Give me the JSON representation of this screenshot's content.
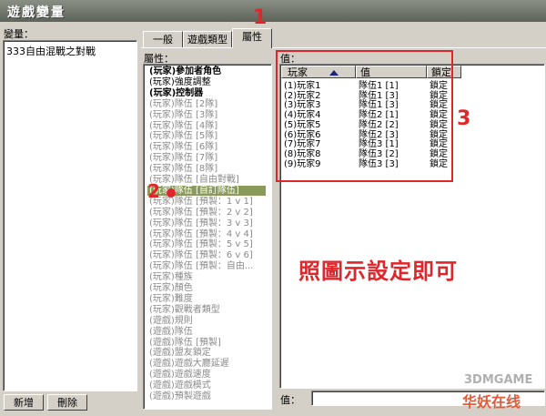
{
  "window": {
    "title": "遊戲變量"
  },
  "variables": {
    "label": "變量：",
    "items": [
      "333自由混戰之對戰"
    ]
  },
  "buttons": {
    "add": "新增",
    "delete": "刪除"
  },
  "tabs": [
    "一般",
    "遊戲類型",
    "屬性"
  ],
  "attributes": {
    "label": "屬性：",
    "items": [
      {
        "text": "(玩家)參加者角色",
        "state": "bold"
      },
      {
        "text": "(玩家)強度調整",
        "state": "normal"
      },
      {
        "text": "(玩家)控制器",
        "state": "bold"
      },
      {
        "text": "(玩家)隊伍 [2隊]",
        "state": "dim"
      },
      {
        "text": "(玩家)隊伍 [3隊]",
        "state": "dim"
      },
      {
        "text": "(玩家)隊伍 [4隊]",
        "state": "dim"
      },
      {
        "text": "(玩家)隊伍 [5隊]",
        "state": "dim"
      },
      {
        "text": "(玩家)隊伍 [6隊]",
        "state": "dim"
      },
      {
        "text": "(玩家)隊伍 [7隊]",
        "state": "dim"
      },
      {
        "text": "(玩家)隊伍 [8隊]",
        "state": "dim"
      },
      {
        "text": "(玩家)隊伍 [自由對戰]",
        "state": "dim"
      },
      {
        "text": "(玩家)隊伍 [自訂隊伍]",
        "state": "selected"
      },
      {
        "text": "(玩家)隊伍 [預製：1 v 1]",
        "state": "dim"
      },
      {
        "text": "(玩家)隊伍 [預製：2 v 2]",
        "state": "dim"
      },
      {
        "text": "(玩家)隊伍 [預製：3 v 3]",
        "state": "dim"
      },
      {
        "text": "(玩家)隊伍 [預製：4 v 4]",
        "state": "dim"
      },
      {
        "text": "(玩家)隊伍 [預製：5 v 5]",
        "state": "dim"
      },
      {
        "text": "(玩家)隊伍 [預製：6 v 6]",
        "state": "dim"
      },
      {
        "text": "(玩家)隊伍 [預製：自由...",
        "state": "dim"
      },
      {
        "text": "(玩家)種族",
        "state": "dim"
      },
      {
        "text": "(玩家)顏色",
        "state": "dim"
      },
      {
        "text": "(玩家)難度",
        "state": "dim"
      },
      {
        "text": "(玩家)觀戰者類型",
        "state": "dim"
      },
      {
        "text": "(遊戲)規則",
        "state": "dim"
      },
      {
        "text": "(遊戲)隊伍",
        "state": "dim"
      },
      {
        "text": "(遊戲)隊伍 [預製]",
        "state": "dim"
      },
      {
        "text": "(遊戲)盟友鎖定",
        "state": "dim"
      },
      {
        "text": "(遊戲)遊戲大廳延遲",
        "state": "dim"
      },
      {
        "text": "(遊戲)遊戲速度",
        "state": "dim"
      },
      {
        "text": "(遊戲)遊戲模式",
        "state": "dim"
      },
      {
        "text": "(遊戲)預製遊戲",
        "state": "dim"
      }
    ]
  },
  "values": {
    "label": "值：",
    "headers": [
      "玩家",
      "值",
      "鎖定"
    ],
    "rows": [
      [
        "(1)玩家1",
        "隊伍1 [1]",
        "鎖定"
      ],
      [
        "(2)玩家2",
        "隊伍1 [3]",
        "鎖定"
      ],
      [
        "(3)玩家3",
        "隊伍1 [3]",
        "鎖定"
      ],
      [
        "(4)玩家4",
        "隊伍2 [1]",
        "鎖定"
      ],
      [
        "(5)玩家5",
        "隊伍2 [2]",
        "鎖定"
      ],
      [
        "(6)玩家6",
        "隊伍2 [3]",
        "鎖定"
      ],
      [
        "(7)玩家7",
        "隊伍3 [1]",
        "鎖定"
      ],
      [
        "(8)玩家8",
        "隊伍3 [2]",
        "鎖定"
      ],
      [
        "(9)玩家9",
        "隊伍3 [3]",
        "鎖定"
      ]
    ]
  },
  "bottom_value_label": "值：",
  "annotations": {
    "mark1": "1",
    "mark2": "2",
    "mark3": "3",
    "caption": "照圖示設定即可",
    "color": "#e0262b"
  },
  "watermark": {
    "line1": "3DMGAME",
    "line2": "华妖在线"
  }
}
